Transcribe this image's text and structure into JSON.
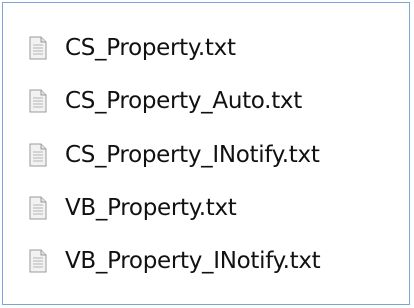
{
  "files": [
    {
      "name": "CS_Property.txt",
      "icon": "text-file-icon"
    },
    {
      "name": "CS_Property_Auto.txt",
      "icon": "text-file-icon"
    },
    {
      "name": "CS_Property_INotify.txt",
      "icon": "text-file-icon"
    },
    {
      "name": "VB_Property.txt",
      "icon": "text-file-icon"
    },
    {
      "name": "VB_Property_INotify.txt",
      "icon": "text-file-icon"
    }
  ],
  "colors": {
    "border": "#7aa7d8",
    "icon_fill": "#f2f2f2",
    "icon_stroke": "#9a9a9a",
    "text": "#111111"
  }
}
